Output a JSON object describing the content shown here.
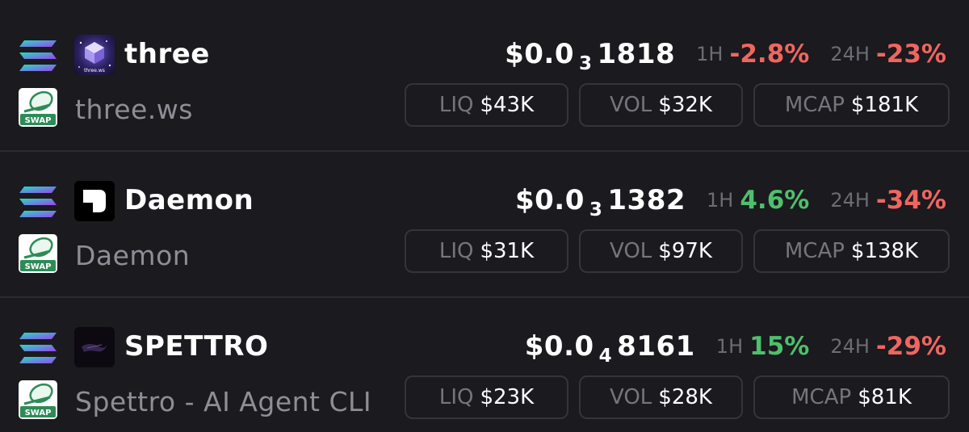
{
  "tokens": [
    {
      "symbol": "three",
      "name": "three.ws",
      "logo_text": "three.ws",
      "price_prefix": "$0.0",
      "price_zeros": "3",
      "price_digits": "1818",
      "h1_label": "1H",
      "h1_change": "-2.8%",
      "h24_label": "24H",
      "h24_change": "-23%",
      "liq_label": "LIQ",
      "liq_value": "$43K",
      "vol_label": "VOL",
      "vol_value": "$32K",
      "mcap_label": "MCAP",
      "mcap_value": "$181K"
    },
    {
      "symbol": "Daemon",
      "name": "Daemon",
      "price_prefix": "$0.0",
      "price_zeros": "3",
      "price_digits": "1382",
      "h1_label": "1H",
      "h1_change": "4.6%",
      "h24_label": "24H",
      "h24_change": "-34%",
      "liq_label": "LIQ",
      "liq_value": "$31K",
      "vol_label": "VOL",
      "vol_value": "$97K",
      "mcap_label": "MCAP",
      "mcap_value": "$138K"
    },
    {
      "symbol": "SPETTRO",
      "name": "Spettro - AI Agent CLI",
      "price_prefix": "$0.0",
      "price_zeros": "4",
      "price_digits": "8161",
      "h1_label": "1H",
      "h1_change": "15%",
      "h24_label": "24H",
      "h24_change": "-29%",
      "liq_label": "LIQ",
      "liq_value": "$23K",
      "vol_label": "VOL",
      "vol_value": "$28K",
      "mcap_label": "MCAP",
      "mcap_value": "$81K"
    }
  ],
  "swap_badge": "SWAP",
  "icons": {
    "chain": "solana-chain-icon",
    "swap": "swap-platform-icon"
  },
  "colors": {
    "background": "#1a1a1f",
    "negative": "#f0665f",
    "positive": "#4fbf6c",
    "muted": "#8e8e96",
    "swap_green": "#2e8b57"
  }
}
